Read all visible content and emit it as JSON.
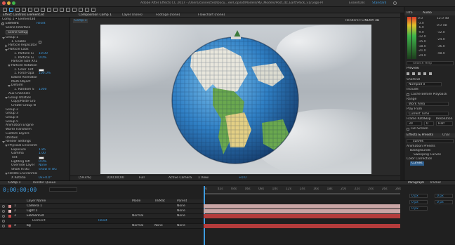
{
  "window": {
    "title": "Adobe After Effects CC 2017 - /Users/connected/Docu...ee/Copilot/Models/My_Models/Post_dz_EarthPack_v1/Lego-Planet-Low-Poly.aep *",
    "workspaces": [
      "Essentials",
      "Standard"
    ],
    "active_workspace": "Standard"
  },
  "effect_controls": {
    "tab": "Effect Controls Element3d",
    "subtitle": "Comp 1 • Element3d",
    "effect_name": "Element",
    "reset": "Reset",
    "scene_interface": "Scene Interface",
    "scene_setup": "Scene Setup",
    "rows": [
      {
        "label": "Group 1",
        "indent": 0,
        "open": true
      },
      {
        "label": "1. Enable",
        "indent": 2,
        "value": "",
        "check": true
      },
      {
        "label": "Particle Replicator",
        "indent": 1,
        "open": false
      },
      {
        "label": "Particle Look",
        "indent": 1,
        "open": true
      },
      {
        "label": "1. Particle Si",
        "indent": 3,
        "value": "10.00"
      },
      {
        "label": "1. Particle Si",
        "indent": 3,
        "value": "0.0%"
      },
      {
        "label": "Particle Size XYZ",
        "indent": 2
      },
      {
        "label": "Particle Rotation",
        "indent": 2,
        "open": true
      },
      {
        "label": "1. Color Tint",
        "indent": 3,
        "swatch": true
      },
      {
        "label": "1. Force Opa",
        "indent": 3,
        "value": "100.0%"
      },
      {
        "label": "Baked Animation",
        "indent": 2
      },
      {
        "label": "Multi-Object",
        "indent": 2
      },
      {
        "label": "Deform",
        "indent": 2,
        "open": true
      },
      {
        "label": "1. Random S",
        "indent": 3,
        "value": "1000"
      },
      {
        "label": "Aux Channels",
        "indent": 1
      },
      {
        "label": "Group Utilities",
        "indent": 1,
        "open": true
      },
      {
        "label": "Copy/Paste Gro",
        "indent": 2
      },
      {
        "label": "Create Group N",
        "indent": 2
      },
      {
        "label": "Group 2",
        "indent": 0
      },
      {
        "label": "Group 3",
        "indent": 0
      },
      {
        "label": "Group 4",
        "indent": 0
      },
      {
        "label": "Group 5",
        "indent": 0
      },
      {
        "label": "Animation Engine",
        "indent": 0
      },
      {
        "label": "World Transform",
        "indent": 0
      },
      {
        "label": "Custom Layers",
        "indent": 0
      },
      {
        "label": "Utilities",
        "indent": 0
      },
      {
        "label": "Render Settings",
        "indent": 0,
        "open": true
      },
      {
        "label": "Physical Environment",
        "indent": 1,
        "open": true
      },
      {
        "label": "Exposure",
        "indent": 2,
        "value": "1.85"
      },
      {
        "label": "Gamma",
        "indent": 2,
        "value": "1.00"
      },
      {
        "label": "Tint",
        "indent": 2,
        "swatch": true
      },
      {
        "label": "Lighting Infl",
        "indent": 2,
        "value": "0.0%"
      },
      {
        "label": "Override Layer",
        "indent": 2,
        "value": "None"
      },
      {
        "label": "Show In BG",
        "indent": 2,
        "value": "Show In BG"
      },
      {
        "label": "Rotate Environment",
        "indent": 1,
        "open": true
      },
      {
        "label": "X Rotatio",
        "indent": 2,
        "value": "0x+0.0°"
      }
    ]
  },
  "composition": {
    "tab": "Composition Comp 1",
    "layer_tab": "Layer (none)",
    "footage_tab": "Footage (none)",
    "flowchart_tab": "Flowchart (none)",
    "comp_tab": "Comp 1",
    "renderer_label": "Renderer:",
    "renderer_value": "CINEMA 4D",
    "magnification": "(59.4%)",
    "timecode": "0;00;00;00",
    "resolution": "Full",
    "camera": "Active Camera",
    "views": "1 View",
    "exposure": "+0.0"
  },
  "info_audio": {
    "tabs": [
      "Info",
      "Audio"
    ],
    "levels_left": [
      "0.0",
      "-3.0",
      "-6.0",
      "-9.0",
      "-12.0",
      "-15.0",
      "-18.0",
      "-21.0",
      "-24.0"
    ],
    "levels_right": [
      "12.0 dB",
      "0.0 dB",
      "-12.0",
      "-24.0",
      "-36.0",
      "-48.0"
    ]
  },
  "search_help": "Search Help",
  "preview": {
    "title": "Preview",
    "shortcut_label": "Shortcut",
    "shortcut_value": "Numpad 0",
    "include_label": "Include:",
    "cache_label": "Cache Before Playback",
    "range_label": "Range",
    "range_value": "Work Area",
    "play_from_label": "Play From",
    "play_from_value": "Current Time",
    "frame_rate_label": "Frame Rate",
    "skip_label": "Skip",
    "resolution_label": "Resolution",
    "frame_rate_value": "30",
    "skip_value": "0",
    "resolution_value": "Half",
    "fullscreen_label": "Full Screen"
  },
  "effects_presets": {
    "tabs": [
      "Effects & Presets",
      "Char"
    ],
    "search_value": "curves",
    "items": [
      {
        "label": "Animation Presets",
        "indent": 0
      },
      {
        "label": "Backgrounds",
        "indent": 1
      },
      {
        "label": "Sweeping Curves",
        "indent": 2
      },
      {
        "label": "Color Correction",
        "indent": 0
      },
      {
        "label": "Curves",
        "indent": 1
      }
    ]
  },
  "timeline": {
    "tab": "Comp 1",
    "render_queue_tab": "Render Queue",
    "timecode": "0;00;00;00",
    "header": {
      "layer_name": "Layer Name",
      "mode": "Mode",
      "trkmat": "TrkMat",
      "parent": "Parent"
    },
    "layers": [
      {
        "num": "1",
        "name": "Camera 1",
        "color": "#d98f8f",
        "mode": "",
        "trkmat": "",
        "parent": "None"
      },
      {
        "num": "2",
        "name": "Light 1",
        "color": "#e3b9b9",
        "mode": "",
        "trkmat": "",
        "parent": "None"
      },
      {
        "num": "3",
        "name": "Element3d",
        "color": "#c94a4a",
        "mode": "Normal",
        "trkmat": "",
        "parent": "None"
      },
      {
        "num": "",
        "name": "Element",
        "color": "",
        "mode": "",
        "trkmat": "",
        "parent": "",
        "sub": true,
        "reset": "Reset"
      },
      {
        "num": "4",
        "name": "bg",
        "color": "#c94a4a",
        "mode": "Normal",
        "trkmat": "None",
        "parent": "None"
      }
    ],
    "ruler": [
      "0s",
      "02s",
      "04s",
      "06s",
      "08s",
      "10s",
      "12s",
      "14s",
      "16s",
      "18s",
      "20s",
      "22s",
      "24s",
      "26s",
      "28s"
    ]
  },
  "paragraph": {
    "tabs": [
      "Paragraph",
      "Tracker"
    ],
    "fields": [
      "0 px",
      "0 px",
      "0 px",
      "0 px",
      "0 px"
    ]
  },
  "colors": {
    "accent_blue": "#3d9be0",
    "layer_bar_light": "#c9a5a5",
    "layer_bar_red": "#b43c3c"
  }
}
